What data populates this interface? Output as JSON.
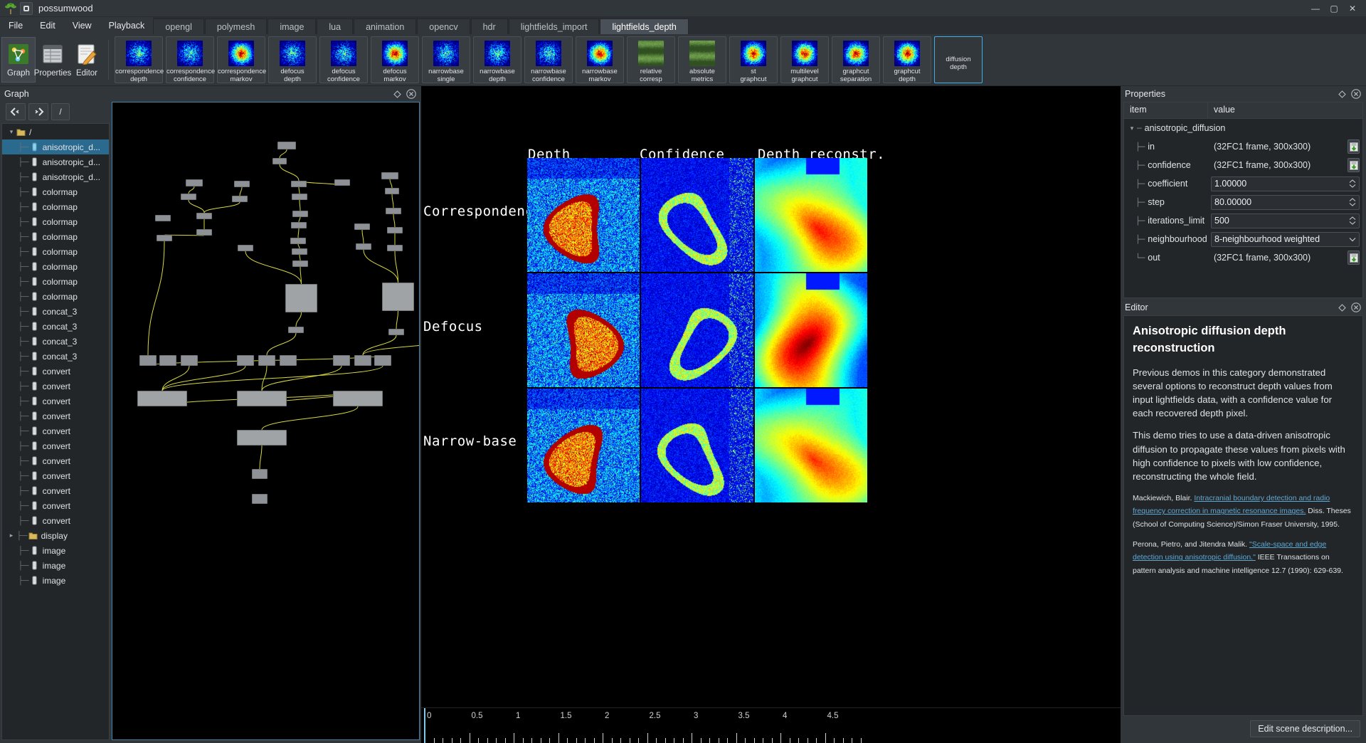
{
  "window": {
    "title": "possumwood",
    "minimize": "—",
    "maximize": "▢",
    "close": "✕"
  },
  "menu": {
    "items": [
      "File",
      "Edit",
      "View",
      "Playback"
    ]
  },
  "tabs": [
    {
      "label": "opengl",
      "selected": false
    },
    {
      "label": "polymesh",
      "selected": false
    },
    {
      "label": "image",
      "selected": false
    },
    {
      "label": "lua",
      "selected": false
    },
    {
      "label": "animation",
      "selected": false
    },
    {
      "label": "opencv",
      "selected": false
    },
    {
      "label": "hdr",
      "selected": false
    },
    {
      "label": "lightfields_import",
      "selected": false
    },
    {
      "label": "lightfields_depth",
      "selected": true
    }
  ],
  "modes": [
    {
      "label": "Graph",
      "icon": "graph-icon",
      "active": false
    },
    {
      "label": "Properties",
      "icon": "properties-icon",
      "active": false
    },
    {
      "label": "Editor",
      "icon": "editor-icon",
      "active": false
    }
  ],
  "toolbar": {
    "buttons": [
      {
        "line1": "correspondence",
        "line2": "depth",
        "selected": false
      },
      {
        "line1": "correspondence",
        "line2": "confidence",
        "selected": false
      },
      {
        "line1": "correspondence",
        "line2": "markov",
        "selected": false
      },
      {
        "line1": "defocus",
        "line2": "depth",
        "selected": false
      },
      {
        "line1": "defocus",
        "line2": "confidence",
        "selected": false
      },
      {
        "line1": "defocus",
        "line2": "markov",
        "selected": false
      },
      {
        "line1": "narrowbase",
        "line2": "single",
        "selected": false
      },
      {
        "line1": "narrowbase",
        "line2": "depth",
        "selected": false
      },
      {
        "line1": "narrowbase",
        "line2": "confidence",
        "selected": false
      },
      {
        "line1": "narrowbase",
        "line2": "markov",
        "selected": false
      },
      {
        "line1": "relative",
        "line2": "corresp",
        "selected": false
      },
      {
        "line1": "absolute",
        "line2": "metrics",
        "selected": false
      },
      {
        "line1": "st",
        "line2": "graphcut",
        "selected": false
      },
      {
        "line1": "multilevel",
        "line2": "graphcut",
        "selected": false
      },
      {
        "line1": "graphcut",
        "line2": "separation",
        "selected": false
      },
      {
        "line1": "graphcut",
        "line2": "depth",
        "selected": false
      },
      {
        "line1": "diffusion",
        "line2": "depth",
        "selected": true
      }
    ]
  },
  "graph_dock": {
    "title": "Graph",
    "nav": {
      "back": "back-icon",
      "forward": "forward-icon",
      "root": "/"
    },
    "tree": [
      {
        "label": "/",
        "type": "folder",
        "depth": 0,
        "selected": false,
        "expanded": true
      },
      {
        "label": "anisotropic_d...",
        "type": "node",
        "depth": 1,
        "selected": true
      },
      {
        "label": "anisotropic_d...",
        "type": "node",
        "depth": 1,
        "selected": false
      },
      {
        "label": "anisotropic_d...",
        "type": "node",
        "depth": 1,
        "selected": false
      },
      {
        "label": "colormap",
        "type": "node",
        "depth": 1,
        "selected": false
      },
      {
        "label": "colormap",
        "type": "node",
        "depth": 1,
        "selected": false
      },
      {
        "label": "colormap",
        "type": "node",
        "depth": 1,
        "selected": false
      },
      {
        "label": "colormap",
        "type": "node",
        "depth": 1,
        "selected": false
      },
      {
        "label": "colormap",
        "type": "node",
        "depth": 1,
        "selected": false
      },
      {
        "label": "colormap",
        "type": "node",
        "depth": 1,
        "selected": false
      },
      {
        "label": "colormap",
        "type": "node",
        "depth": 1,
        "selected": false
      },
      {
        "label": "colormap",
        "type": "node",
        "depth": 1,
        "selected": false
      },
      {
        "label": "concat_3",
        "type": "node",
        "depth": 1,
        "selected": false
      },
      {
        "label": "concat_3",
        "type": "node",
        "depth": 1,
        "selected": false
      },
      {
        "label": "concat_3",
        "type": "node",
        "depth": 1,
        "selected": false
      },
      {
        "label": "concat_3",
        "type": "node",
        "depth": 1,
        "selected": false
      },
      {
        "label": "convert",
        "type": "node",
        "depth": 1,
        "selected": false
      },
      {
        "label": "convert",
        "type": "node",
        "depth": 1,
        "selected": false
      },
      {
        "label": "convert",
        "type": "node",
        "depth": 1,
        "selected": false
      },
      {
        "label": "convert",
        "type": "node",
        "depth": 1,
        "selected": false
      },
      {
        "label": "convert",
        "type": "node",
        "depth": 1,
        "selected": false
      },
      {
        "label": "convert",
        "type": "node",
        "depth": 1,
        "selected": false
      },
      {
        "label": "convert",
        "type": "node",
        "depth": 1,
        "selected": false
      },
      {
        "label": "convert",
        "type": "node",
        "depth": 1,
        "selected": false
      },
      {
        "label": "convert",
        "type": "node",
        "depth": 1,
        "selected": false
      },
      {
        "label": "convert",
        "type": "node",
        "depth": 1,
        "selected": false
      },
      {
        "label": "convert",
        "type": "node",
        "depth": 1,
        "selected": false
      },
      {
        "label": "display",
        "type": "folder",
        "depth": 1,
        "selected": false,
        "expanded": false
      },
      {
        "label": "image",
        "type": "node",
        "depth": 1,
        "selected": false
      },
      {
        "label": "image",
        "type": "node",
        "depth": 1,
        "selected": false
      },
      {
        "label": "image",
        "type": "node",
        "depth": 1,
        "selected": false
      }
    ]
  },
  "viewport": {
    "column_labels": [
      "Depth",
      "Confidence",
      "Depth reconstr."
    ],
    "row_labels": [
      "Correspondence",
      "Defocus",
      "Narrow-base"
    ],
    "timeline": {
      "ticks": [
        "0",
        "0.5",
        "1",
        "1.5",
        "2",
        "2.5",
        "3",
        "3.5",
        "4",
        "4.5"
      ],
      "cursor": "0"
    }
  },
  "properties": {
    "title": "Properties",
    "columns": [
      "item",
      "value"
    ],
    "root": "anisotropic_diffusion",
    "rows": [
      {
        "name": "in",
        "value": "(32FC1 frame, 300x300)",
        "kind": "static",
        "has_save": true
      },
      {
        "name": "confidence",
        "value": "(32FC1 frame, 300x300)",
        "kind": "static",
        "has_save": true
      },
      {
        "name": "coefficient",
        "value": "1.00000",
        "kind": "spinbox",
        "has_save": false
      },
      {
        "name": "step",
        "value": "80.00000",
        "kind": "spinbox",
        "has_save": false
      },
      {
        "name": "iterations_limit",
        "value": "500",
        "kind": "spinbox",
        "has_save": false
      },
      {
        "name": "neighbourhood",
        "value": "8-neighbourhood weighted",
        "kind": "combobox",
        "has_save": false
      },
      {
        "name": "out",
        "value": "(32FC1 frame, 300x300)",
        "kind": "static",
        "has_save": true
      }
    ]
  },
  "editor": {
    "title": "Editor",
    "heading": "Anisotropic diffusion depth reconstruction",
    "paragraphs": [
      "Previous demos in this category demonstrated several options to reconstruct depth values from input lightfields data, with a confidence value for each recovered depth pixel.",
      "This demo tries to use a data-driven anisotropic diffusion to propagate these values from pixels with high confidence to pixels with low confidence, reconstructing the whole field."
    ],
    "references": [
      {
        "pre": "Mackiewich, Blair. ",
        "link": "Intracranial boundary detection and radio frequency correction in magnetic resonance images.",
        "post": " Diss. Theses (School of Computing Science)/Simon Fraser University, 1995."
      },
      {
        "pre": "Perona, Pietro, and Jitendra Malik. ",
        "link": "\"Scale-space and edge detection using anisotropic diffusion.\"",
        "post": " IEEE Transactions on pattern analysis and machine intelligence 12.7 (1990): 629-639."
      }
    ],
    "edit_button": "Edit scene description..."
  },
  "colors": {
    "accent": "#3daee9",
    "panel": "#31363b",
    "dark": "#232629",
    "selection": "#2b6a8f",
    "text": "#eff0f1"
  }
}
